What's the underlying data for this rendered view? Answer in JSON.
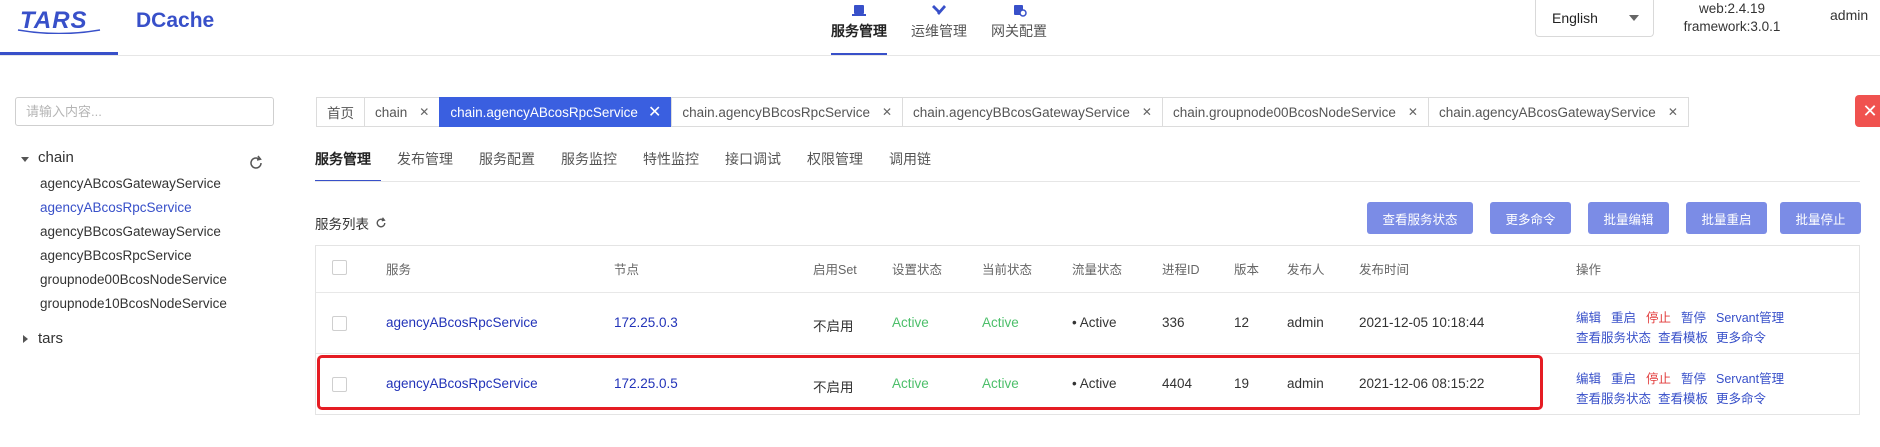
{
  "header": {
    "logo_text": "TARS",
    "dcache_text": "DCache",
    "nav": [
      {
        "label": "服务管理",
        "active": true
      },
      {
        "label": "运维管理",
        "active": false
      },
      {
        "label": "网关配置",
        "active": false
      }
    ],
    "language": "English",
    "version_web": "web:2.4.19",
    "version_framework": "framework:3.0.1",
    "user": "admin"
  },
  "sidebar": {
    "search_placeholder": "请输入内容...",
    "tree": [
      {
        "label": "chain",
        "expanded": true,
        "children": [
          {
            "label": "agencyABcosGatewayService",
            "active": false
          },
          {
            "label": "agencyABcosRpcService",
            "active": true
          },
          {
            "label": "agencyBBcosGatewayService",
            "active": false
          },
          {
            "label": "agencyBBcosRpcService",
            "active": false
          },
          {
            "label": "groupnode00BcosNodeService",
            "active": false
          },
          {
            "label": "groupnode10BcosNodeService",
            "active": false
          }
        ]
      },
      {
        "label": "tars",
        "expanded": false,
        "children": []
      }
    ]
  },
  "tabs": [
    {
      "label": "首页",
      "closable": false,
      "active": false
    },
    {
      "label": "chain",
      "closable": true,
      "active": false
    },
    {
      "label": "chain.agencyABcosRpcService",
      "closable": true,
      "active": true
    },
    {
      "label": "chain.agencyBBcosRpcService",
      "closable": true,
      "active": false
    },
    {
      "label": "chain.agencyBBcosGatewayService",
      "closable": true,
      "active": false
    },
    {
      "label": "chain.groupnode00BcosNodeService",
      "closable": true,
      "active": false
    },
    {
      "label": "chain.agencyABcosGatewayService",
      "closable": true,
      "active": false
    }
  ],
  "subtabs": [
    "服务管理",
    "发布管理",
    "服务配置",
    "服务监控",
    "特性监控",
    "接口调试",
    "权限管理",
    "调用链"
  ],
  "list": {
    "title": "服务列表",
    "buttons": [
      "查看服务状态",
      "更多命令",
      "批量编辑",
      "批量重启",
      "批量停止"
    ],
    "columns": [
      "服务",
      "节点",
      "启用Set",
      "设置状态",
      "当前状态",
      "流量状态",
      "进程ID",
      "版本",
      "发布人",
      "发布时间",
      "操作"
    ],
    "rows": [
      {
        "service": "agencyABcosRpcService",
        "node": "172.25.0.3",
        "set": "不启用",
        "setting_state": "Active",
        "present_state": "Active",
        "flow_state": "• Active",
        "pid": "336",
        "version": "12",
        "publisher": "admin",
        "time": "2021-12-05 10:18:44"
      },
      {
        "service": "agencyABcosRpcService",
        "node": "172.25.0.5",
        "set": "不启用",
        "setting_state": "Active",
        "present_state": "Active",
        "flow_state": "• Active",
        "pid": "4404",
        "version": "19",
        "publisher": "admin",
        "time": "2021-12-06 08:15:22"
      }
    ],
    "operations_line1": [
      "编辑",
      "重启",
      "停止",
      "暂停",
      "Servant管理"
    ],
    "operations_line2": [
      "查看服务状态",
      "查看模板",
      "更多命令"
    ]
  },
  "colors": {
    "brand": "#3850c9",
    "active_tab": "#3a5fe0",
    "button": "#7b8ce6",
    "success": "#4cbf6a",
    "danger": "#e23b3b",
    "highlight": "#e51c23"
  }
}
